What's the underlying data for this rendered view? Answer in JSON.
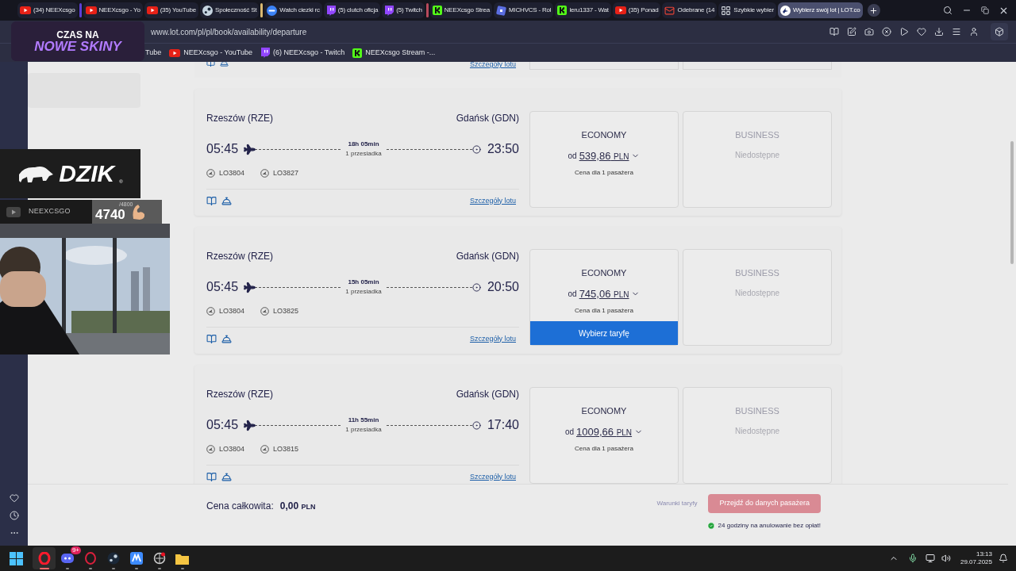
{
  "tabs": [
    {
      "kind": "youtube",
      "title": "(34) NEEXcsgo",
      "selected": false
    },
    {
      "kind": "youtube",
      "title": "NEEXcsgo - Yo",
      "selected": false,
      "color": "#5b3fd6"
    },
    {
      "kind": "youtube",
      "title": "(35) YouTube",
      "selected": false
    },
    {
      "kind": "steam",
      "title": "Społeczność St",
      "selected": false
    },
    {
      "kind": "link",
      "title": "Watch ciezki rc",
      "selected": false,
      "color": "#d9b870"
    },
    {
      "kind": "twitch",
      "title": "(5) clutch oficja",
      "selected": false
    },
    {
      "kind": "twitch",
      "title": "(5) Twitch",
      "selected": false
    },
    {
      "kind": "kick",
      "title": "NEEXcsgo Strea",
      "selected": false,
      "color": "#b84a5c"
    },
    {
      "kind": "square",
      "title": "MICHVCS - Rol",
      "selected": false
    },
    {
      "kind": "kick",
      "title": "leru1337 - Wat",
      "selected": false
    },
    {
      "kind": "youtube",
      "title": "(35) Ponad",
      "selected": false
    },
    {
      "kind": "mail",
      "title": "Odebrane (14",
      "selected": false
    },
    {
      "kind": "grid",
      "title": "Szybkie wybier",
      "selected": false
    },
    {
      "kind": "lot",
      "title": "Wybierz swój lot | LOT.co",
      "selected": true
    }
  ],
  "address": "www.lot.com/pl/pl/book/availability/departure",
  "bookmarks": [
    {
      "kind": "none",
      "title": "Tube"
    },
    {
      "kind": "youtube",
      "title": "NEEXcsgo - YouTube"
    },
    {
      "kind": "twitch",
      "title": "(6) NEEXcsgo - Twitch"
    },
    {
      "kind": "kick",
      "title": "NEEXcsgo Stream -..."
    }
  ],
  "stream_overlay": {
    "promo_line_1": "CZAS NA",
    "promo_line_2": "NOWE SKINY",
    "sponsor": "DZIK",
    "sponsor_mark": "®",
    "channel": "NEEXCSGO",
    "goal": "/4800",
    "count": "4740"
  },
  "partial_card": {
    "details_link": "Szczegóły lotu"
  },
  "flights": [
    {
      "from": "Rzeszów (RZE)",
      "to": "Gdańsk (GDN)",
      "departure": "05:45",
      "arrival": "23:50",
      "duration": "18h 05min",
      "stops": "1 przesiadka",
      "flight_numbers": [
        "LO3804",
        "LO3827"
      ],
      "details_link": "Szczegóły lotu",
      "economy": {
        "label": "ECONOMY",
        "prefix": "od",
        "price": "539,86",
        "currency": "PLN",
        "note": "Cena dla 1 pasażera"
      },
      "business": {
        "label": "BUSINESS",
        "status": "Niedostępne"
      }
    },
    {
      "from": "Rzeszów (RZE)",
      "to": "Gdańsk (GDN)",
      "departure": "05:45",
      "arrival": "20:50",
      "duration": "15h 05min",
      "stops": "1 przesiadka",
      "flight_numbers": [
        "LO3804",
        "LO3825"
      ],
      "details_link": "Szczegóły lotu",
      "economy": {
        "label": "ECONOMY",
        "prefix": "od",
        "price": "745,06",
        "currency": "PLN",
        "note": "Cena dla 1 pasażera",
        "button": "Wybierz taryfę"
      },
      "business": {
        "label": "BUSINESS",
        "status": "Niedostępne"
      }
    },
    {
      "from": "Rzeszów (RZE)",
      "to": "Gdańsk (GDN)",
      "departure": "05:45",
      "arrival": "17:40",
      "duration": "11h 55min",
      "stops": "1 przesiadka",
      "flight_numbers": [
        "LO3804",
        "LO3815"
      ],
      "details_link": "Szczegóły lotu",
      "economy": {
        "label": "ECONOMY",
        "prefix": "od",
        "price": "1009,66",
        "currency": "PLN",
        "note": "Cena dla 1 pasażera"
      },
      "business": {
        "label": "BUSINESS",
        "status": "Niedostępne"
      }
    }
  ],
  "footer": {
    "total_label": "Cena całkowita:",
    "total": "0,00",
    "currency": "PLN",
    "terms_link": "Warunki taryfy",
    "terms_disabled": true,
    "continue_button": "Przejdź do danych pasażera",
    "continue_disabled": true,
    "cancel_note": "24 godziny na anulowanie bez opłat!"
  },
  "taskbar": {
    "apps": [
      {
        "kind": "opera",
        "active": true
      },
      {
        "kind": "discord",
        "active": false,
        "badge": "9+"
      },
      {
        "kind": "opera-gx",
        "active": false
      },
      {
        "kind": "steam",
        "active": false
      },
      {
        "kind": "app",
        "active": false
      },
      {
        "kind": "globe",
        "active": false
      },
      {
        "kind": "folder",
        "active": false
      }
    ],
    "time": "13:13",
    "date": "29.07.2025"
  }
}
